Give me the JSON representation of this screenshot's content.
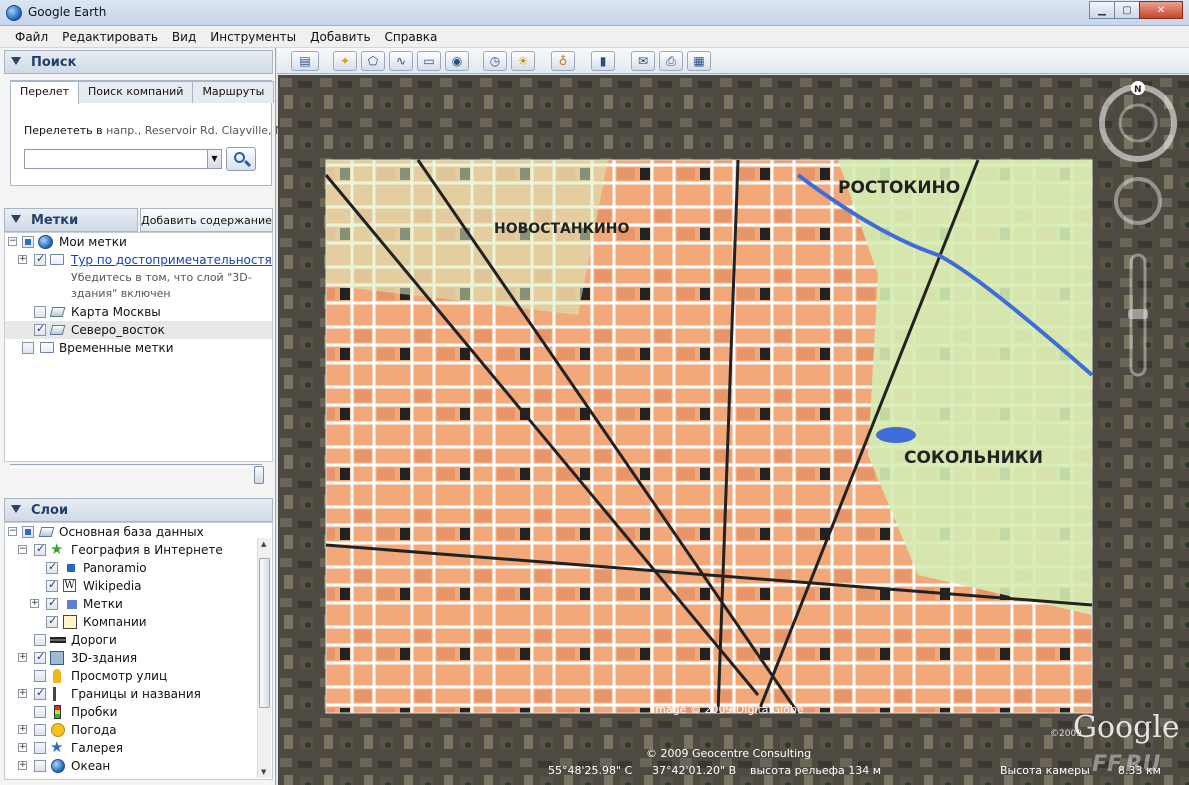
{
  "window": {
    "title": "Google Earth"
  },
  "menu": [
    "Файл",
    "Редактировать",
    "Вид",
    "Инструменты",
    "Добавить",
    "Справка"
  ],
  "search": {
    "header": "Поиск",
    "tabs": [
      "Перелет",
      "Поиск компаний",
      "Маршруты"
    ],
    "fly_label": "Перелететь в",
    "fly_hint": "напр., Reservoir Rd. Clayville, NY",
    "input_value": ""
  },
  "places": {
    "header": "Метки",
    "add_content": "Добавить содержание",
    "items": [
      {
        "label": "Мои метки"
      },
      {
        "label": "Тур по достопримечательностям",
        "note1": "Убедитесь в том, что слой \"3D-",
        "note2": "здания\" включен"
      },
      {
        "label": "Карта Москвы"
      },
      {
        "label": "Северо_восток"
      },
      {
        "label": "Временные метки"
      }
    ]
  },
  "layers": {
    "header": "Слои",
    "items": [
      {
        "label": "Основная база данных"
      },
      {
        "label": "География в Интернете"
      },
      {
        "label": "Panoramio"
      },
      {
        "label": "Wikipedia"
      },
      {
        "label": "Метки"
      },
      {
        "label": "Компании"
      },
      {
        "label": "Дороги"
      },
      {
        "label": "3D-здания"
      },
      {
        "label": "Просмотр улиц"
      },
      {
        "label": "Границы и названия"
      },
      {
        "label": "Пробки"
      },
      {
        "label": "Погода"
      },
      {
        "label": "Галерея"
      },
      {
        "label": "Океан"
      }
    ]
  },
  "map": {
    "labels": {
      "rostokino": "РОСТОКИНО",
      "novostankino": "НОВОСТАНКИНО",
      "sokolniki": "СОКОЛЬНИКИ"
    },
    "compass_n": "N",
    "copyright_image": "Image © 2009 DigitalGlobe",
    "copyright_data": "© 2009 Geocentre Consulting",
    "logo": "Google",
    "logo_year": "©2009",
    "status": {
      "lat": "55°48'25.98\" С",
      "lon": "37°42'01.20\" В",
      "elevation": "высота рельефа  134 м",
      "camera": "Высота камеры",
      "camera_value": "8.33 км"
    },
    "watermark": "FF.RU"
  }
}
